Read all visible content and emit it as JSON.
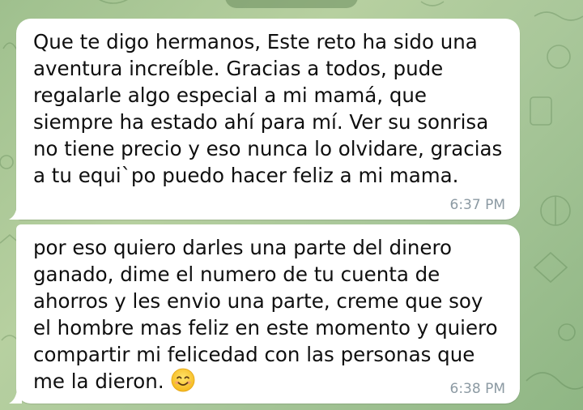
{
  "chat": {
    "date_pill": "",
    "messages": [
      {
        "text": "Que te digo hermanos, Este reto ha sido una\naventura increíble. Gracias a todos, pude\nregalarle algo especial a mi mamá, que\nsiempre ha estado ahí para mí. Ver su sonrisa\nno tiene precio y eso nunca lo olvidare, gracias\na tu equi`po puedo hacer feliz a mi mama.",
        "time": "6:37 PM"
      },
      {
        "text": "por eso quiero darles una parte del dinero\nganado, dime el numero de tu cuenta de\nahorros y les envio una parte, creme que soy\nel hombre mas feliz en este momento y quiero\ncompartir mi felicedad con las personas que\nme la dieron.",
        "emoji": "smiling-face-icon",
        "time": "6:38 PM"
      }
    ]
  },
  "colors": {
    "wallpaper": "#a9c79a",
    "bubble": "#ffffff",
    "text": "#0f0f0f",
    "timestamp": "#8c9aa3"
  }
}
